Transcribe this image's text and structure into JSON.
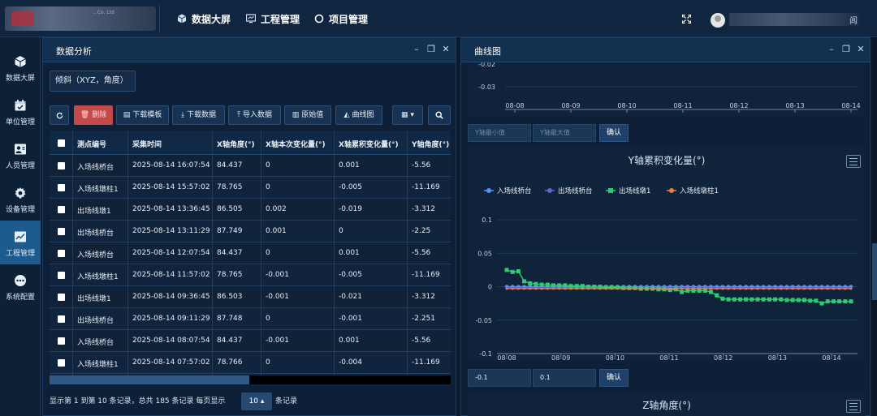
{
  "header": {
    "logo_caption": "...Co. Ltd",
    "nav": [
      {
        "label": "数据大屏",
        "icon": "cube-icon"
      },
      {
        "label": "工程管理",
        "icon": "monitor-icon"
      },
      {
        "label": "项目管理",
        "icon": "circle-icon"
      }
    ],
    "username_tail": "闾"
  },
  "sidebar": {
    "items": [
      {
        "label": "数据大屏",
        "icon": "cube-icon",
        "active": false
      },
      {
        "label": "单位管理",
        "icon": "calendar-icon",
        "active": false
      },
      {
        "label": "人员管理",
        "icon": "person-card-icon",
        "active": false
      },
      {
        "label": "设备管理",
        "icon": "gear-icon",
        "active": false
      },
      {
        "label": "工程管理",
        "icon": "chart-icon",
        "active": true
      },
      {
        "label": "系统配置",
        "icon": "dots-icon",
        "active": false
      }
    ]
  },
  "left_panel": {
    "title": "数据分析",
    "type_selector": "倾斜（XYZ，角度）",
    "toolbar": {
      "refresh_icon": "refresh-icon",
      "delete": "删除",
      "download_template": "下载模板",
      "download_data": "下载数据",
      "import_data": "导入数据",
      "raw_values": "原始值",
      "curve": "曲线图",
      "columns_icon": "grid-icon",
      "search_icon": "search-icon"
    },
    "table": {
      "headers": [
        "测点编号",
        "采集时间",
        "X轴角度(°)",
        "X轴本次变化量(°)",
        "X轴累积变化量(°)",
        "Y轴角度(°)"
      ],
      "rows": [
        [
          "入场线桥台",
          "2025-08-14 16:07:54",
          "84.437",
          "0",
          "0.001",
          "-5.56"
        ],
        [
          "入场线墩柱1",
          "2025-08-14 15:57:02",
          "78.765",
          "0",
          "-0.005",
          "-11.169"
        ],
        [
          "出场线墩1",
          "2025-08-14 13:36:45",
          "86.505",
          "0.002",
          "-0.019",
          "-3.312"
        ],
        [
          "出场线桥台",
          "2025-08-14 13:11:29",
          "87.749",
          "0.001",
          "0",
          "-2.25"
        ],
        [
          "入场线桥台",
          "2025-08-14 12:07:54",
          "84.437",
          "0",
          "0.001",
          "-5.56"
        ],
        [
          "入场线墩柱1",
          "2025-08-14 11:57:02",
          "78.765",
          "-0.001",
          "-0.005",
          "-11.169"
        ],
        [
          "出场线墩1",
          "2025-08-14 09:36:45",
          "86.503",
          "-0.001",
          "-0.021",
          "-3.312"
        ],
        [
          "出场线桥台",
          "2025-08-14 09:11:29",
          "87.748",
          "0",
          "-0.001",
          "-2.251"
        ],
        [
          "入场线桥台",
          "2025-08-14 08:07:54",
          "84.437",
          "-0.001",
          "0.001",
          "-5.56"
        ],
        [
          "入场线墩柱1",
          "2025-08-14 07:57:02",
          "78.766",
          "0",
          "-0.004",
          "-11.169"
        ]
      ]
    },
    "pager": {
      "summary": "显示第 1 到第 10 条记录，总共 185 条记录 每页显示",
      "page_size": "10 ▴",
      "suffix": "条记录"
    }
  },
  "right_panel": {
    "title": "曲线图",
    "y_min_placeholder": "Y轴最小值",
    "y_max_placeholder": "Y轴最大值",
    "confirm": "确认",
    "min_value": "-0.1",
    "max_value": "0.1",
    "next_chart_title": "Z轴角度(°)"
  },
  "chart_data": [
    {
      "type": "line",
      "title": "",
      "x": [
        "08-08",
        "08-09",
        "08-10",
        "08-11",
        "08-12",
        "08-13",
        "08-14"
      ],
      "yticks": [
        "-0.02",
        "-0.03"
      ],
      "note": "partially scrolled chart, only bottom visible"
    },
    {
      "type": "line",
      "title": "Y轴累积变化量(°)",
      "x": [
        "08-08",
        "08-09",
        "08-10",
        "08-11",
        "08-12",
        "08-13",
        "08-14"
      ],
      "ylim": [
        -0.1,
        0.1
      ],
      "yticks": [
        "0.1",
        "0.05",
        "0",
        "-0.05",
        "-0.1"
      ],
      "legend": "top-left",
      "series": [
        {
          "name": "入场线桥台",
          "color": "#5b8ff9",
          "values": [
            0,
            0,
            0,
            0,
            0,
            0,
            0,
            0,
            0,
            0,
            0,
            0,
            0,
            0,
            0,
            0,
            0,
            0,
            0,
            0,
            0,
            0,
            0,
            0,
            0,
            0,
            0,
            0,
            0,
            0,
            0,
            0,
            0,
            0,
            0,
            0,
            0,
            0,
            0,
            0,
            0,
            0,
            0,
            0,
            0,
            0,
            0,
            0,
            0,
            0,
            0,
            0,
            0,
            0,
            0,
            0,
            0,
            0,
            0,
            0
          ]
        },
        {
          "name": "出场线桥台",
          "color": "#6b5fd3",
          "values": [
            -0.002,
            -0.002,
            -0.002,
            -0.002,
            -0.002,
            -0.002,
            -0.002,
            -0.002,
            -0.002,
            -0.002,
            -0.002,
            -0.002,
            -0.002,
            -0.002,
            -0.002,
            -0.002,
            -0.002,
            -0.002,
            -0.002,
            -0.002,
            -0.002,
            -0.002,
            -0.002,
            -0.002,
            -0.002,
            -0.002,
            -0.002,
            -0.002,
            -0.002,
            -0.002,
            -0.002,
            -0.002,
            -0.002,
            -0.002,
            -0.002,
            -0.002,
            -0.002,
            -0.002,
            -0.002,
            -0.002,
            -0.002,
            -0.002,
            -0.002,
            -0.002,
            -0.002,
            -0.002,
            -0.002,
            -0.002,
            -0.002,
            -0.002,
            -0.002,
            -0.002,
            -0.002,
            -0.002,
            -0.002,
            -0.002,
            -0.002,
            -0.002,
            -0.002,
            -0.002
          ]
        },
        {
          "name": "出场线墩1",
          "color": "#2ecc71",
          "values": [
            0.025,
            0.022,
            0.023,
            0.008,
            0.005,
            0.004,
            0.003,
            0.003,
            0.002,
            0.002,
            0.002,
            0.001,
            0.001,
            0.001,
            0,
            0,
            0,
            -0.001,
            -0.001,
            -0.001,
            -0.002,
            -0.002,
            -0.002,
            -0.003,
            -0.003,
            -0.003,
            -0.004,
            -0.004,
            -0.005,
            -0.004,
            -0.008,
            -0.006,
            -0.006,
            -0.006,
            -0.006,
            -0.008,
            -0.013,
            -0.018,
            -0.019,
            -0.019,
            -0.019,
            -0.019,
            -0.019,
            -0.019,
            -0.019,
            -0.019,
            -0.019,
            -0.019,
            -0.02,
            -0.02,
            -0.02,
            -0.02,
            -0.021,
            -0.021,
            -0.025,
            -0.022,
            -0.022,
            -0.022,
            -0.022,
            -0.022
          ]
        },
        {
          "name": "入场线墩柱1",
          "color": "#f07a4a",
          "values": [
            -0.003,
            -0.003,
            -0.003,
            -0.003,
            -0.003,
            -0.003,
            -0.003,
            -0.003,
            -0.003,
            -0.003,
            -0.003,
            -0.003,
            -0.003,
            -0.003,
            -0.003,
            -0.003,
            -0.003,
            -0.003,
            -0.003,
            -0.003,
            -0.003,
            -0.003,
            -0.003,
            -0.003,
            -0.003,
            -0.003,
            -0.003,
            -0.003,
            -0.003,
            -0.003,
            -0.003,
            -0.003,
            -0.003,
            -0.003,
            -0.003,
            -0.003,
            -0.003,
            -0.003,
            -0.003,
            -0.003,
            -0.003,
            -0.003,
            -0.003,
            -0.003,
            -0.003,
            -0.003,
            -0.003,
            -0.003,
            -0.003,
            -0.003,
            -0.003,
            -0.003,
            -0.003,
            -0.003,
            -0.003,
            -0.003,
            -0.003,
            -0.003,
            -0.003,
            -0.003
          ]
        }
      ]
    }
  ],
  "colors": {
    "accent": "#1d5a8e",
    "danger": "#c44a4a",
    "background": "#0b1a2e"
  }
}
